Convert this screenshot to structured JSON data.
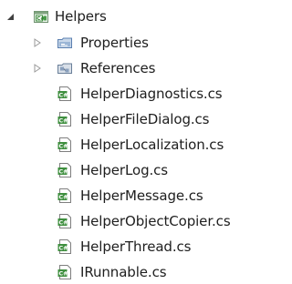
{
  "solution_explorer": {
    "project": {
      "name": "Helpers",
      "expander_icon": "expanded-triangle-icon",
      "icon": "csharp-project-icon"
    },
    "folders": [
      {
        "label": "Properties",
        "icon": "properties-folder-icon",
        "expander_icon": "collapsed-triangle-icon"
      },
      {
        "label": "References",
        "icon": "references-folder-icon",
        "expander_icon": "collapsed-triangle-icon"
      }
    ],
    "files": [
      {
        "label": "HelperDiagnostics.cs",
        "icon": "csharp-file-icon"
      },
      {
        "label": "HelperFileDialog.cs",
        "icon": "csharp-file-icon"
      },
      {
        "label": "HelperLocalization.cs",
        "icon": "csharp-file-icon"
      },
      {
        "label": "HelperLog.cs",
        "icon": "csharp-file-icon"
      },
      {
        "label": "HelperMessage.cs",
        "icon": "csharp-file-icon"
      },
      {
        "label": "HelperObjectCopier.cs",
        "icon": "csharp-file-icon"
      },
      {
        "label": "HelperThread.cs",
        "icon": "csharp-file-icon"
      },
      {
        "label": "IRunnable.cs",
        "icon": "csharp-file-icon"
      }
    ]
  },
  "colors": {
    "text": "#1e1e1e",
    "expander": "#404040",
    "expander_collapsed": "#9a9a9a",
    "csharp_green": "#3f8f3f",
    "folder_blue": "#5b7fb0"
  }
}
